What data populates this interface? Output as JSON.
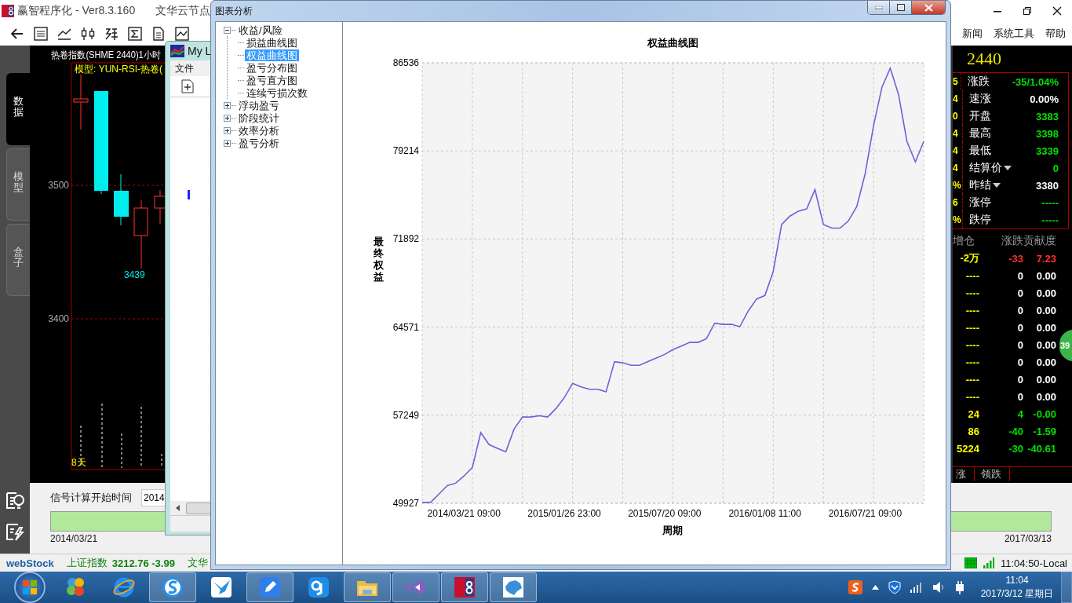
{
  "app": {
    "title": "赢智程序化  -  Ver8.3.160",
    "node": "文华云节点",
    "menu": [
      "新闻",
      "系统工具",
      "帮助"
    ]
  },
  "side_tabs": [
    {
      "label": "数据",
      "selected": true
    },
    {
      "label": "模型",
      "selected": false
    },
    {
      "label": "盒子",
      "selected": false
    }
  ],
  "kline": {
    "title": "热卷指数(SHME 2440)1小时",
    "model": "模型: YUN-RSI-热卷(",
    "price_labels": [
      "3500",
      "3400"
    ],
    "low_label": "3439",
    "period": "8天"
  },
  "quote": {
    "code": "2440",
    "rows": [
      {
        "edge": "5",
        "label": "涨跌",
        "value": "-35/1.04%",
        "color": "#00e000",
        "dropdown": false
      },
      {
        "edge": "4",
        "label": "速涨",
        "value": "0.00%",
        "color": "#ffffff",
        "dropdown": false
      },
      {
        "edge": "0",
        "label": "开盘",
        "value": "3383",
        "color": "#00e000",
        "dropdown": false
      },
      {
        "edge": "4",
        "label": "最高",
        "value": "3398",
        "color": "#00e000",
        "dropdown": false
      },
      {
        "edge": "4",
        "label": "最低",
        "value": "3339",
        "color": "#00e000",
        "dropdown": false
      },
      {
        "edge": "4",
        "label": "结算价",
        "value": "0",
        "color": "#00e000",
        "dropdown": true
      },
      {
        "edge": "%",
        "label": "昨结",
        "value": "3380",
        "color": "#ffffff",
        "dropdown": true
      },
      {
        "edge": "6",
        "label": "涨停",
        "value": "-----",
        "color": "#00e000",
        "dropdown": false
      },
      {
        "edge": "%",
        "label": "跌停",
        "value": "-----",
        "color": "#00e000",
        "dropdown": false
      }
    ]
  },
  "contrib": {
    "columns": [
      "增仓",
      "涨跌",
      "贡献度"
    ],
    "rows": [
      {
        "cells": [
          "-2万",
          "-33",
          "7.23"
        ],
        "color": "#ff3030"
      },
      {
        "cells": [
          "----",
          "0",
          "0.00"
        ],
        "color": "#ffffff"
      },
      {
        "cells": [
          "----",
          "0",
          "0.00"
        ],
        "color": "#ffffff"
      },
      {
        "cells": [
          "----",
          "0",
          "0.00"
        ],
        "color": "#ffffff"
      },
      {
        "cells": [
          "----",
          "0",
          "0.00"
        ],
        "color": "#ffffff"
      },
      {
        "cells": [
          "----",
          "0",
          "0.00"
        ],
        "color": "#ffffff"
      },
      {
        "cells": [
          "----",
          "0",
          "0.00"
        ],
        "color": "#ffffff"
      },
      {
        "cells": [
          "----",
          "0",
          "0.00"
        ],
        "color": "#ffffff"
      },
      {
        "cells": [
          "----",
          "0",
          "0.00"
        ],
        "color": "#ffffff"
      },
      {
        "cells": [
          "24",
          "4",
          "-0.00"
        ],
        "color": "#00e000"
      },
      {
        "cells": [
          "86",
          "-40",
          "-1.59"
        ],
        "color": "#00e000"
      },
      {
        "cells": [
          "5224",
          "-30",
          "-40.61"
        ],
        "color": "#00e000"
      }
    ],
    "tabs": [
      "涨",
      "领跌"
    ],
    "badge": "39"
  },
  "signal": {
    "label": "信号计算开始时间",
    "value": "2014",
    "start": "2014/03/21",
    "end": "2017/03/13"
  },
  "status_bar": {
    "logo": "webStock",
    "index_name": "上证指数",
    "index_value": "3212.76 -3.99",
    "node": "文华",
    "clock": "11:04:50-Local"
  },
  "child_window": {
    "title": "My L",
    "menu": "文件"
  },
  "dialog": {
    "title": "图表分析",
    "tree": [
      {
        "label": "收益/风险",
        "expanded": true,
        "selected": false,
        "children": [
          {
            "label": "损益曲线图",
            "selected": false
          },
          {
            "label": "权益曲线图",
            "selected": true
          },
          {
            "label": "盈亏分布图",
            "selected": false
          },
          {
            "label": "盈亏直方图",
            "selected": false
          },
          {
            "label": "连续亏损次数",
            "selected": false
          }
        ]
      },
      {
        "label": "浮动盈亏",
        "expanded": false,
        "selected": false
      },
      {
        "label": "阶段统计",
        "expanded": false,
        "selected": false
      },
      {
        "label": "效率分析",
        "expanded": false,
        "selected": false
      },
      {
        "label": "盈亏分析",
        "expanded": false,
        "selected": false
      }
    ],
    "chart_data": {
      "type": "line",
      "title": "权益曲线图",
      "xlabel": "周期",
      "ylabel": "最终权益",
      "categories": [
        null,
        null,
        null,
        null,
        null,
        "2014/03/21 09:00",
        null,
        null,
        null,
        null,
        null,
        null,
        null,
        null,
        null,
        null,
        null,
        "2015/01/26 23:00",
        null,
        null,
        null,
        null,
        null,
        null,
        null,
        null,
        null,
        null,
        null,
        "2015/07/20 09:00",
        null,
        null,
        null,
        null,
        null,
        null,
        null,
        null,
        null,
        null,
        null,
        "2016/01/08 11:00",
        null,
        null,
        null,
        null,
        null,
        null,
        null,
        null,
        null,
        null,
        null,
        "2016/07/21 09:00",
        null,
        null,
        null,
        null,
        null,
        null,
        null
      ],
      "series": [
        {
          "color": "#6b63d6",
          "values": [
            50000,
            50000,
            50700,
            51400,
            51600,
            52200,
            52900,
            55800,
            54800,
            54500,
            54200,
            56100,
            57100,
            57100,
            57200,
            57100,
            57800,
            58700,
            59900,
            59600,
            59400,
            59400,
            59200,
            61700,
            61600,
            61400,
            61400,
            61700,
            62000,
            62300,
            62700,
            63000,
            63300,
            63300,
            63600,
            64900,
            64800,
            64800,
            64600,
            65900,
            66900,
            67200,
            69200,
            73100,
            73800,
            74200,
            74400,
            76000,
            73100,
            72800,
            72800,
            73400,
            74600,
            77300,
            81300,
            84500,
            86100,
            83900,
            80000,
            78300,
            80000
          ]
        }
      ],
      "ylim": [
        49927,
        86536
      ],
      "grid": true,
      "yticks": [
        49927,
        57249,
        64571,
        71892,
        79214,
        86536
      ]
    }
  },
  "taskbar": {
    "apps": [
      {
        "open": false
      },
      {
        "open": false
      },
      {
        "open": true
      },
      {
        "open": false
      },
      {
        "open": true
      },
      {
        "open": false
      },
      {
        "open": true
      },
      {
        "open": true
      },
      {
        "open": true
      },
      {
        "open": true
      }
    ],
    "time": "11:04",
    "date": "2017/3/12 星期日"
  }
}
